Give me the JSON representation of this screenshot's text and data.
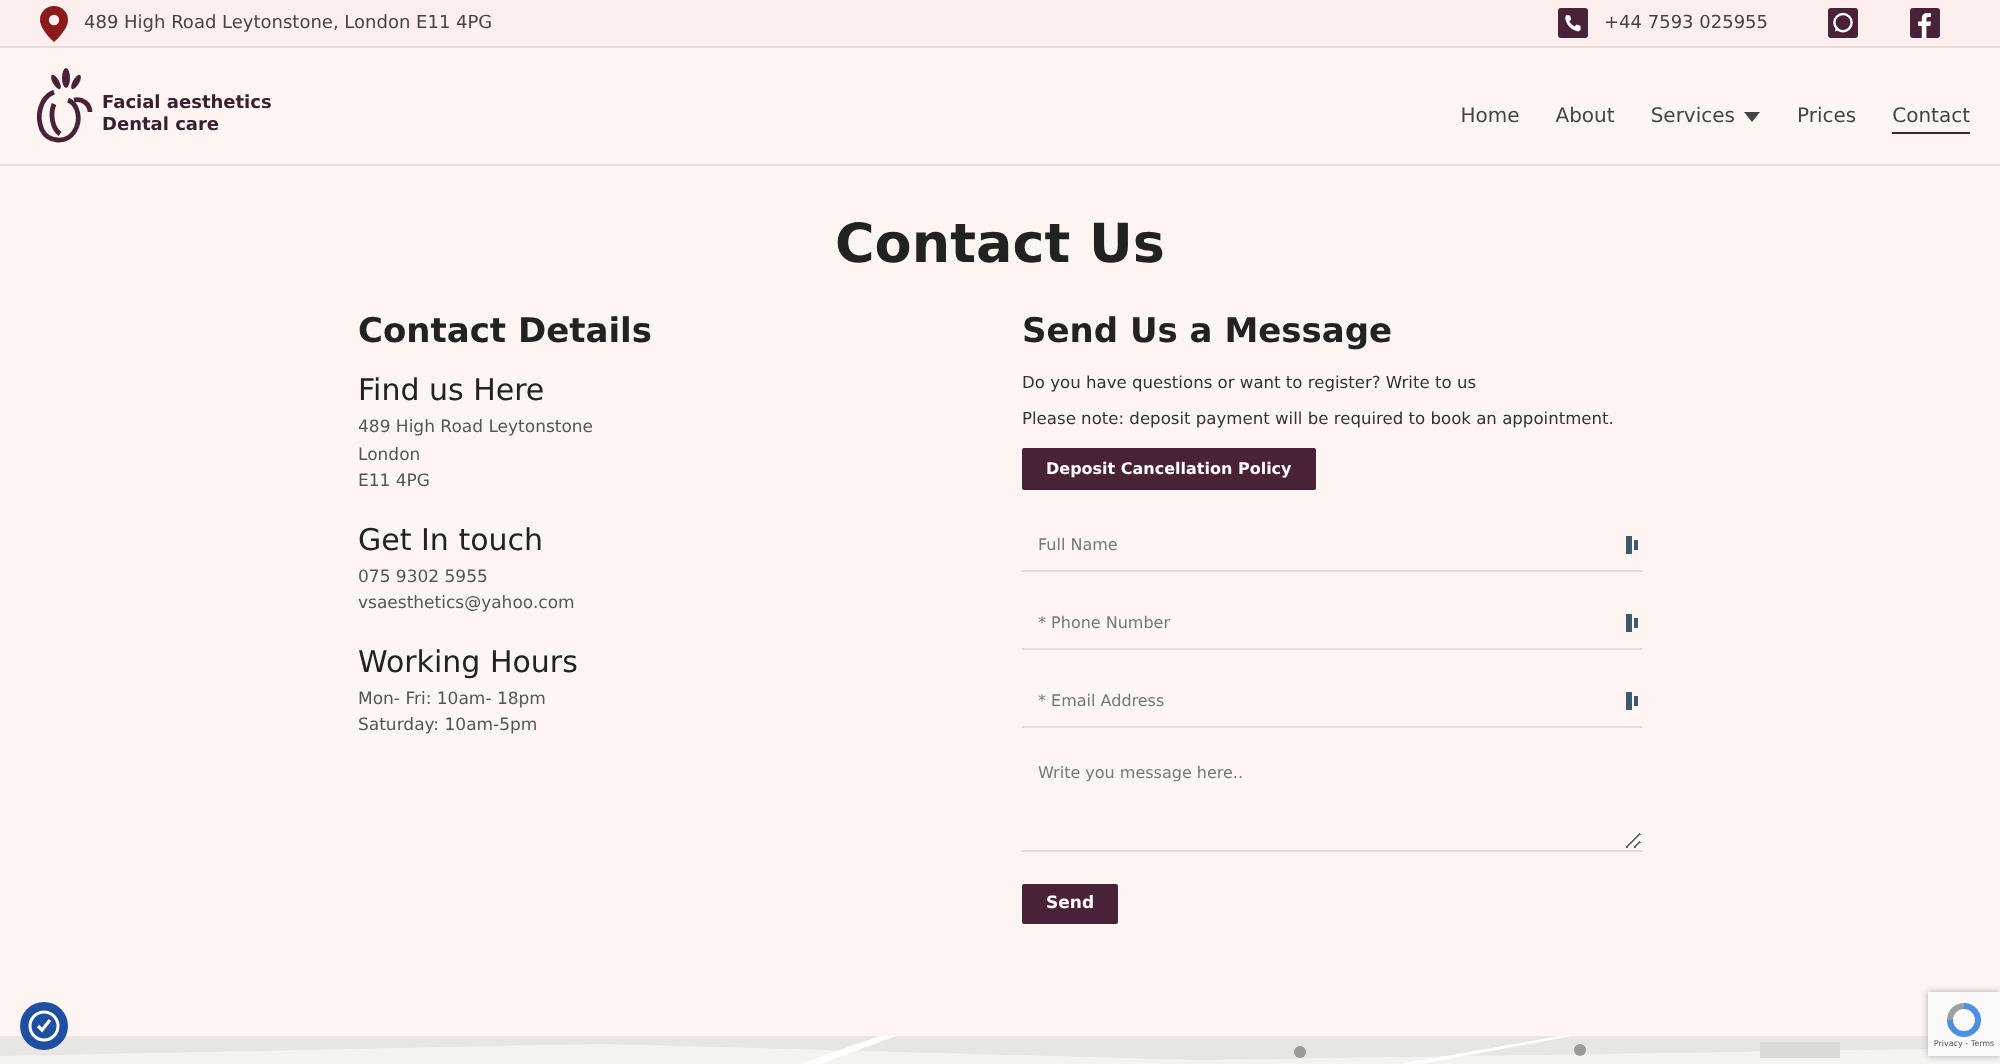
{
  "top_bar": {
    "address": "489 High Road Leytonstone, London E11 4PG",
    "phone": "+44 7593 025955"
  },
  "logo": {
    "line_1": "Facial aesthetics",
    "line_2": "Dental care"
  },
  "nav": [
    {
      "label": "Home",
      "selected": false,
      "dropdown": false
    },
    {
      "label": "About",
      "selected": false,
      "dropdown": false
    },
    {
      "label": "Services",
      "selected": false,
      "dropdown": true
    },
    {
      "label": "Prices",
      "selected": false,
      "dropdown": false
    },
    {
      "label": "Contact",
      "selected": true,
      "dropdown": false
    }
  ],
  "page_title": "Contact Us",
  "contact_details": {
    "title": "Contact Details",
    "sections": [
      {
        "heading": "Find us Here",
        "lines": [
          "489 High Road Leytonstone",
          "London",
          "E11 4PG"
        ]
      },
      {
        "heading": "Get In touch",
        "lines": [
          "075 9302 5955",
          "vsaesthetics@yahoo.com"
        ]
      },
      {
        "heading": "Working Hours",
        "lines": [
          "Mon- Fri: 10am- 18pm",
          "Saturday: 10am-5pm"
        ]
      }
    ]
  },
  "message_form": {
    "title": "Send Us a Message",
    "intro": "Do you have questions or want to register? Write to us",
    "note": "Please note: deposit payment will be required to book an appointment.",
    "policy_button": "Deposit Cancellation Policy",
    "fields": [
      {
        "kind": "input",
        "placeholder": "Full Name"
      },
      {
        "kind": "input",
        "placeholder": "* Phone Number"
      },
      {
        "kind": "input",
        "placeholder": "* Email Address"
      },
      {
        "kind": "textarea",
        "placeholder": "Write you message here.."
      }
    ],
    "submit": "Send"
  },
  "recaptcha": {
    "links": "Privacy - Terms"
  }
}
